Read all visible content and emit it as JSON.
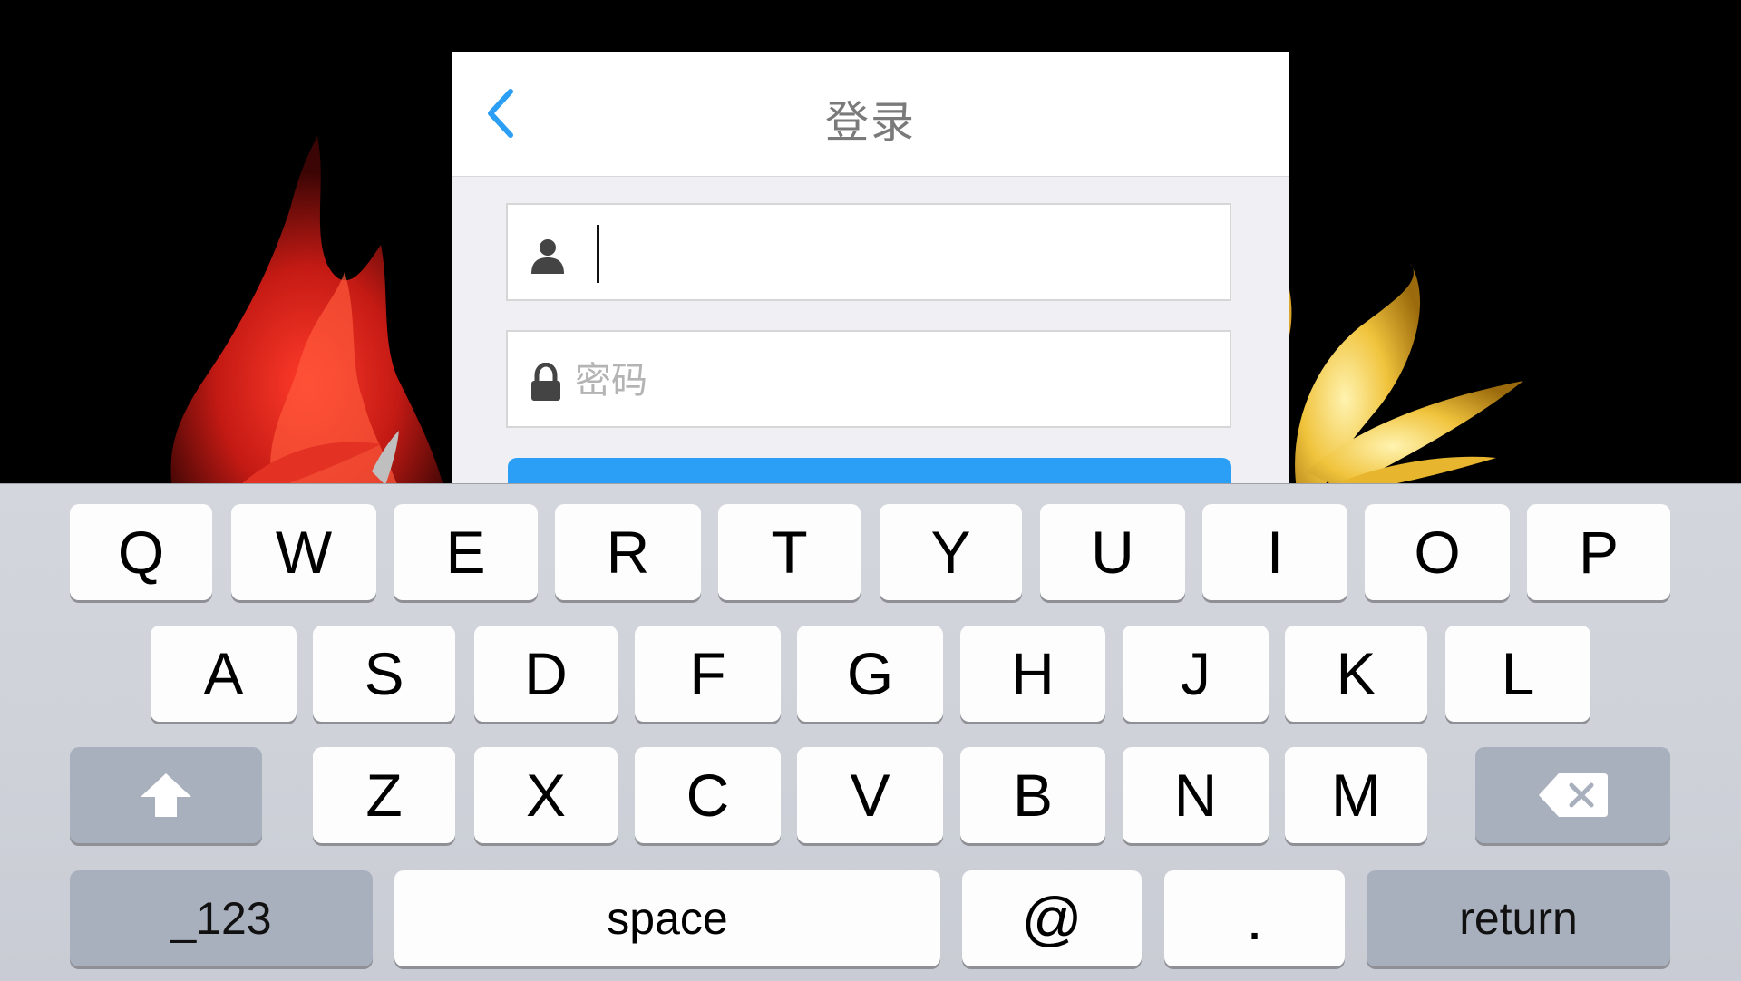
{
  "dialog": {
    "title": "登录",
    "username": {
      "value": "",
      "placeholder": ""
    },
    "password": {
      "value": "",
      "placeholder": "密码"
    }
  },
  "keyboard": {
    "row1": [
      "Q",
      "W",
      "E",
      "R",
      "T",
      "Y",
      "U",
      "I",
      "O",
      "P"
    ],
    "row2": [
      "A",
      "S",
      "D",
      "F",
      "G",
      "H",
      "J",
      "K",
      "L"
    ],
    "row3": [
      "Z",
      "X",
      "C",
      "V",
      "B",
      "N",
      "M"
    ],
    "numbers_label": "_123",
    "space_label": "space",
    "at_label": "@",
    "dot_label": ".",
    "return_label": "return"
  },
  "icons": {
    "back": "chevron-left-icon",
    "user": "user-icon",
    "lock": "lock-icon",
    "shift": "shift-arrow-icon",
    "delete": "backspace-icon"
  },
  "colors": {
    "accent": "#2a9ff5",
    "dialog_bg": "#efeff4",
    "keyboard_bg": "#d0d3da",
    "modifier_key": "#a9b0bd"
  }
}
